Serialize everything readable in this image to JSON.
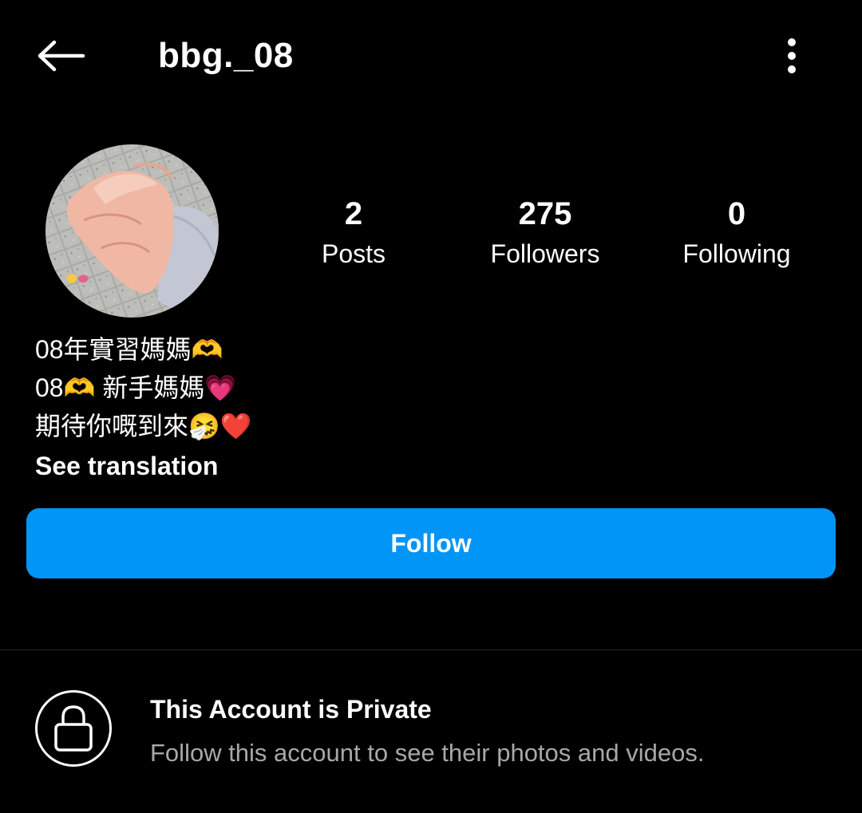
{
  "header": {
    "username": "bbg._08",
    "back_icon": "arrow-left-icon",
    "more_icon": "more-vertical-icon"
  },
  "profile": {
    "stats": {
      "posts_count": "2",
      "posts_label": "Posts",
      "followers_count": "275",
      "followers_label": "Followers",
      "following_count": "0",
      "following_label": "Following"
    },
    "bio": {
      "line1": "08年實習媽媽🫶",
      "line2": "08🫶 新手媽媽💗",
      "line3": "期待你嘅到來🤧❤️"
    },
    "see_translation": "See translation"
  },
  "follow_button": {
    "label": "Follow",
    "color": "#0095f6"
  },
  "private_notice": {
    "icon": "lock-icon",
    "title": "This Account is Private",
    "subtitle": "Follow this account to see their photos and videos."
  }
}
